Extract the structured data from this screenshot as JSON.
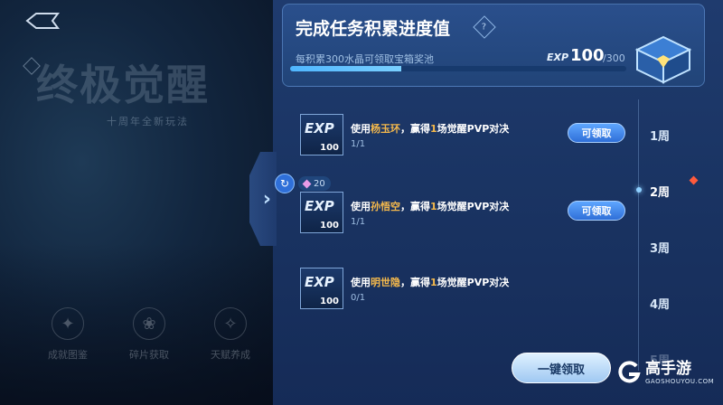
{
  "left": {
    "art_title": "终极觉醒",
    "art_subtitle": "十周年全新玩法",
    "menu": [
      {
        "label": "成就图鉴",
        "icon": "achievement-emblem-icon"
      },
      {
        "label": "碎片获取",
        "icon": "fragment-flower-icon"
      },
      {
        "label": "天赋养成",
        "icon": "talent-crest-icon"
      }
    ]
  },
  "header": {
    "title": "完成任务积累进度值",
    "help_icon": "?",
    "description": "每积累300水晶可领取宝箱奖池",
    "exp_label": "EXP",
    "exp_current": "100",
    "exp_max": "/300",
    "progress": 0.33
  },
  "tasks": [
    {
      "prefix": "使用",
      "hero": "杨玉环",
      "mid": "，赢得",
      "count": "1",
      "suffix": "场觉醒PVP对决",
      "progress": "1/1",
      "exp_text": "EXP",
      "exp_value": "100",
      "button": "可领取"
    },
    {
      "prefix": "使用",
      "hero": "孙悟空",
      "mid": "，赢得",
      "count": "1",
      "suffix": "场觉醒PVP对决",
      "progress": "1/1",
      "exp_text": "EXP",
      "exp_value": "100",
      "button": "可领取"
    },
    {
      "prefix": "使用",
      "hero": "明世隐",
      "mid": "，赢得",
      "count": "1",
      "suffix": "场觉醒PVP对决",
      "progress": "0/1",
      "exp_text": "EXP",
      "exp_value": "100",
      "refresh_cost": "20"
    }
  ],
  "weeks": [
    "1周",
    "2周",
    "3周",
    "4周",
    "5周"
  ],
  "selected_week": "2周",
  "claim_all": "一键领取",
  "watermark": {
    "main": "高手游",
    "sub": "GAOSHOUYOU.COM"
  },
  "colors": {
    "accent": "#2f6fd8",
    "hero_highlight": "#f5b94c",
    "panel_bg": "#1a3463"
  }
}
